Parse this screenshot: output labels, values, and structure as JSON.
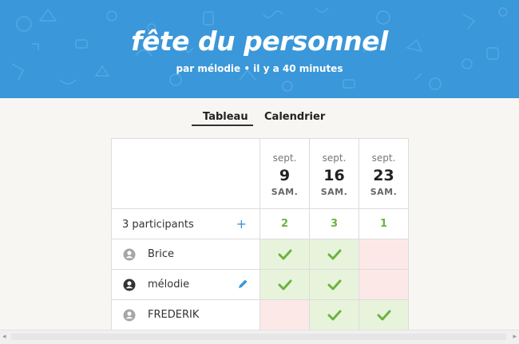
{
  "header": {
    "title": "fête du personnel",
    "subtitle": "par mélodie • il y a 40 minutes",
    "background_color": "#3a97d9"
  },
  "tabs": [
    {
      "label": "Tableau",
      "active": true
    },
    {
      "label": "Calendrier",
      "active": false
    }
  ],
  "dates": [
    {
      "month": "sept.",
      "day": "9",
      "weekday": "SAM."
    },
    {
      "month": "sept.",
      "day": "16",
      "weekday": "SAM."
    },
    {
      "month": "sept.",
      "day": "23",
      "weekday": "SAM."
    }
  ],
  "summary": {
    "participants_label": "3 participants",
    "add_icon": "plus-icon",
    "counts": [
      "2",
      "3",
      "1"
    ]
  },
  "participants": [
    {
      "name": "Brice",
      "avatar": "user-icon",
      "editable": false,
      "votes": [
        true,
        true,
        false
      ]
    },
    {
      "name": "mélodie",
      "avatar": "user-icon",
      "editable": true,
      "votes": [
        true,
        true,
        false
      ]
    },
    {
      "name": "FREDERIK",
      "avatar": "user-icon",
      "editable": false,
      "votes": [
        false,
        true,
        true
      ]
    }
  ],
  "colors": {
    "yes": "#e8f3dc",
    "no": "#fde8e8",
    "check": "#6cb33f",
    "accent": "#3a97d9"
  }
}
